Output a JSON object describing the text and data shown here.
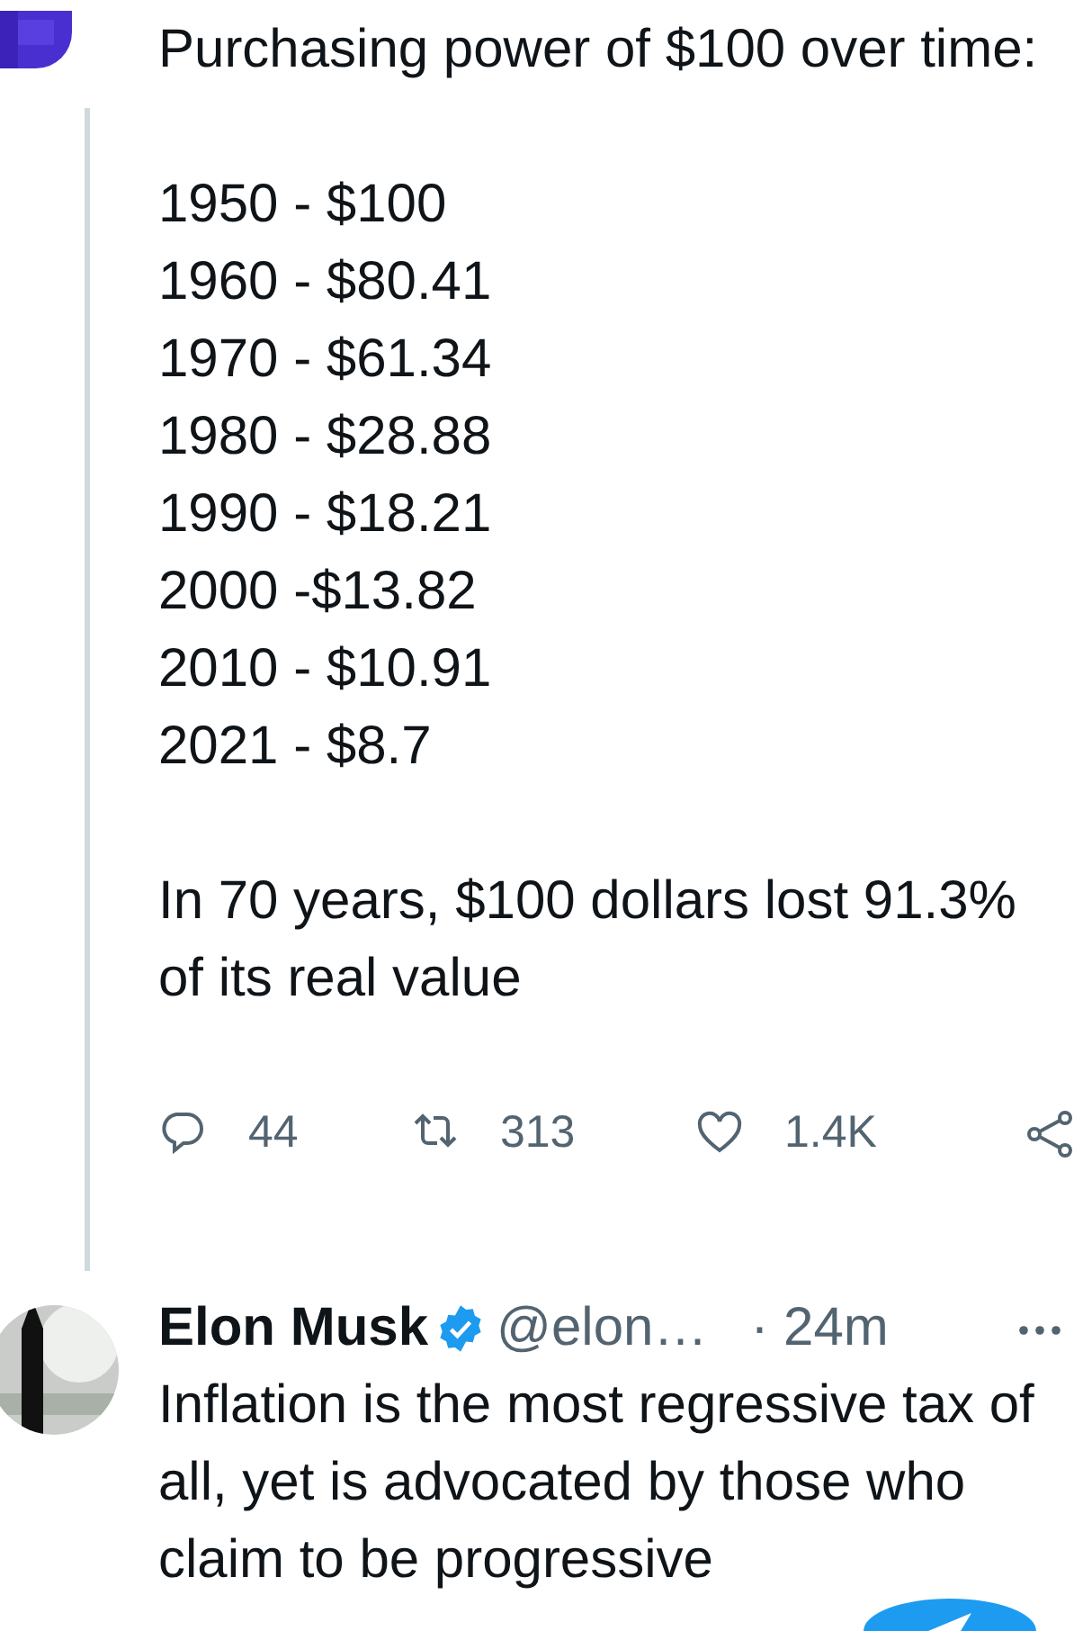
{
  "tweets": [
    {
      "avatar": {
        "kind": "picture"
      },
      "paragraphs": [
        [
          "Purchasing power of $100 over time:"
        ],
        [
          "1950 - $100",
          "1960 - $80.41",
          "1970 - $61.34",
          "1980 - $28.88",
          "1990 - $18.21",
          "2000 -$13.82",
          "2010 - $10.91",
          "2021 - $8.7"
        ],
        [
          "In 70 years, $100 dollars lost 91.3% of its real value"
        ]
      ],
      "actions": [
        {
          "kind": "reply",
          "count": "44"
        },
        {
          "kind": "retweet",
          "count": "313"
        },
        {
          "kind": "like",
          "count": "1.4K"
        },
        {
          "kind": "share"
        }
      ]
    },
    {
      "avatar": {
        "kind": "picture"
      },
      "name": "Elon Musk",
      "verified": true,
      "handle": "@elon…",
      "time": "· 24m",
      "paragraphs": [
        [
          "Inflation is the most regressive tax of all, yet is advocated by those who claim to be progressive"
        ]
      ]
    }
  ]
}
